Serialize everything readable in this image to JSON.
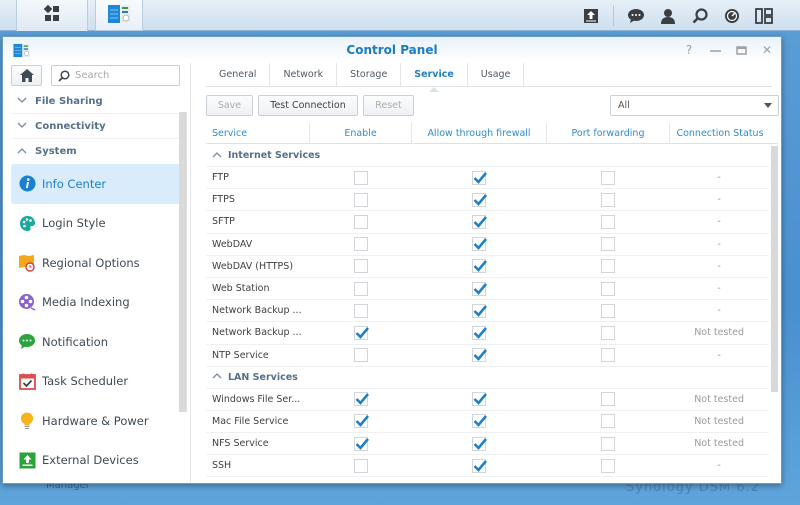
{
  "taskbar": {
    "left_buttons": [
      {
        "name": "main-menu",
        "icon": "grid-apps-icon"
      },
      {
        "name": "control-panel",
        "icon": "control-panel-icon"
      }
    ],
    "right_icons": [
      "upload-icon",
      "chat-icon",
      "user-icon",
      "search-icon",
      "dashboard-icon",
      "widgets-icon"
    ]
  },
  "window": {
    "title": "Control Panel",
    "controls": [
      "help",
      "minimize",
      "maximize",
      "close"
    ],
    "help_glyph": "?",
    "close_glyph": "✕"
  },
  "sidebar": {
    "search_placeholder": "Search",
    "groups": [
      {
        "label": "File Sharing",
        "expanded": false
      },
      {
        "label": "Connectivity",
        "expanded": false
      },
      {
        "label": "System",
        "expanded": true
      }
    ],
    "items": [
      {
        "label": "Info Center",
        "icon": "info-icon",
        "active": true
      },
      {
        "label": "Login Style",
        "icon": "palette-icon",
        "active": false
      },
      {
        "label": "Regional Options",
        "icon": "map-clock-icon",
        "active": false
      },
      {
        "label": "Media Indexing",
        "icon": "film-reel-icon",
        "active": false
      },
      {
        "label": "Notification",
        "icon": "chat-bubble-icon",
        "active": false
      },
      {
        "label": "Task Scheduler",
        "icon": "calendar-check-icon",
        "active": false
      },
      {
        "label": "Hardware & Power",
        "icon": "lightbulb-icon",
        "active": false
      },
      {
        "label": "External Devices",
        "icon": "upload-box-icon",
        "active": false
      }
    ]
  },
  "tabs": [
    {
      "label": "General",
      "active": false
    },
    {
      "label": "Network",
      "active": false
    },
    {
      "label": "Storage",
      "active": false
    },
    {
      "label": "Service",
      "active": true
    },
    {
      "label": "Usage",
      "active": false
    }
  ],
  "toolbar": {
    "save_label": "Save",
    "test_label": "Test Connection",
    "reset_label": "Reset",
    "filter_value": "All"
  },
  "grid": {
    "columns": [
      "Service",
      "Enable",
      "Allow through firewall",
      "Port forwarding",
      "Connection Status"
    ],
    "groups": [
      {
        "label": "Internet Services",
        "rows": [
          {
            "service": "FTP",
            "enable": false,
            "firewall": true,
            "port_forwarding": false,
            "status": "-"
          },
          {
            "service": "FTPS",
            "enable": false,
            "firewall": true,
            "port_forwarding": false,
            "status": "-"
          },
          {
            "service": "SFTP",
            "enable": false,
            "firewall": true,
            "port_forwarding": false,
            "status": "-"
          },
          {
            "service": "WebDAV",
            "enable": false,
            "firewall": true,
            "port_forwarding": false,
            "status": "-"
          },
          {
            "service": "WebDAV (HTTPS)",
            "enable": false,
            "firewall": true,
            "port_forwarding": false,
            "status": "-"
          },
          {
            "service": "Web Station",
            "enable": false,
            "firewall": true,
            "port_forwarding": false,
            "status": "-"
          },
          {
            "service": "Network Backup ...",
            "enable": false,
            "firewall": true,
            "port_forwarding": false,
            "status": "-"
          },
          {
            "service": "Network Backup ...",
            "enable": true,
            "firewall": true,
            "port_forwarding": false,
            "status": "Not tested"
          },
          {
            "service": "NTP Service",
            "enable": false,
            "firewall": true,
            "port_forwarding": false,
            "status": "-"
          }
        ]
      },
      {
        "label": "LAN Services",
        "rows": [
          {
            "service": "Windows File Ser...",
            "enable": true,
            "firewall": true,
            "port_forwarding": false,
            "status": "Not tested"
          },
          {
            "service": "Mac File Service",
            "enable": true,
            "firewall": true,
            "port_forwarding": false,
            "status": "Not tested"
          },
          {
            "service": "NFS Service",
            "enable": true,
            "firewall": true,
            "port_forwarding": false,
            "status": "Not tested"
          },
          {
            "service": "SSH",
            "enable": false,
            "firewall": true,
            "port_forwarding": false,
            "status": "-"
          }
        ]
      }
    ]
  },
  "desktop": {
    "partial_label": "Manager",
    "watermark": "Synology DSM 6.2"
  },
  "colors": {
    "accent": "#1f7fc4",
    "check": "#1f80c8",
    "active_bg": "#d8ecfb",
    "desktop": "#4a8fce"
  }
}
